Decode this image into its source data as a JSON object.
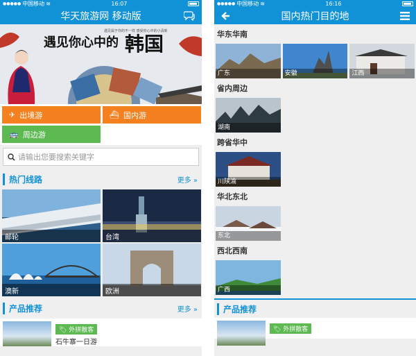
{
  "colors": {
    "brand": "#1292d6",
    "orange": "#f4801f",
    "green": "#5db951"
  },
  "left": {
    "status": {
      "carrier": "中国移动",
      "time": "16:07"
    },
    "header": {
      "title": "华天旅游网 移动版",
      "chat_icon": "chat-bubbles-icon"
    },
    "banner": {
      "title": "遇见你心中的",
      "title_big": "韩国",
      "subtitle": "遇见属于你的不一样 感受你心中的小清新"
    },
    "categories": [
      {
        "label": "出境游",
        "icon": "airplane-icon"
      },
      {
        "label": "国内游",
        "icon": "ship-icon"
      },
      {
        "label": "周边游",
        "icon": "bus-icon"
      }
    ],
    "search": {
      "placeholder": "请输出您要搜索关键字"
    },
    "hot_routes": {
      "title": "热门线路",
      "more": "更多 »"
    },
    "routes": [
      {
        "label": "邮轮"
      },
      {
        "label": "台湾"
      },
      {
        "label": "澳新"
      },
      {
        "label": "欧洲"
      }
    ],
    "products": {
      "title": "产品推荐",
      "more": "更多 »",
      "badge": "外拼散客",
      "name": "石牛寨一日游"
    }
  },
  "right": {
    "status": {
      "carrier": "中国移动",
      "time": "16:16"
    },
    "header": {
      "title": "国内热门目的地"
    },
    "groups": [
      {
        "title": "华东华南",
        "items": [
          {
            "label": "广东"
          },
          {
            "label": "安徽"
          },
          {
            "label": "江西"
          }
        ]
      },
      {
        "title": "省内周边",
        "items": [
          {
            "label": "湖南"
          }
        ]
      },
      {
        "title": "跨省华中",
        "items": [
          {
            "label": "川陕渝"
          }
        ]
      },
      {
        "title": "华北东北",
        "items": [
          {
            "label": "东北"
          }
        ]
      },
      {
        "title": "西北西南",
        "items": [
          {
            "label": "广西"
          }
        ]
      }
    ],
    "products": {
      "title": "产品推荐",
      "badge": "外拼散客"
    }
  }
}
